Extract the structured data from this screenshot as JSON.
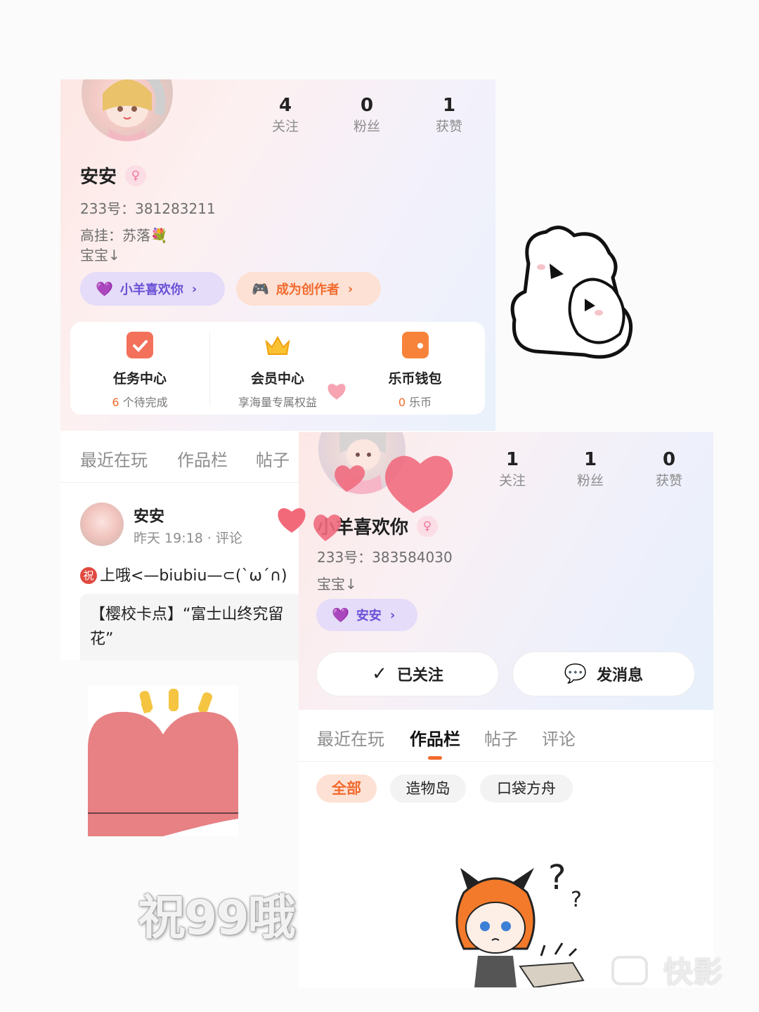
{
  "profile_a": {
    "stats": [
      {
        "value": "4",
        "label": "关注"
      },
      {
        "value": "0",
        "label": "粉丝"
      },
      {
        "value": "1",
        "label": "获赞"
      }
    ],
    "name": "安安",
    "gender_icon": "female-icon",
    "id_line": "233号：381283211",
    "bio_line1": "高挂：苏落💐",
    "bio_line2": "宝宝↓",
    "pills": [
      {
        "icon": "heart-icon",
        "label": "小羊喜欢你"
      },
      {
        "icon": "gamepad-icon",
        "label": "成为创作者"
      }
    ],
    "panel": [
      {
        "icon": "calendar-check-icon",
        "title": "任务中心",
        "sub_highlight": "6",
        "sub": " 个待完成"
      },
      {
        "icon": "crown-icon",
        "title": "会员中心",
        "sub_highlight": "",
        "sub": "享海量专属权益"
      },
      {
        "icon": "wallet-icon",
        "title": "乐币钱包",
        "sub_highlight": "0",
        "sub": " 乐币"
      }
    ],
    "tabs": [
      "最近在玩",
      "作品栏",
      "帖子"
    ],
    "post": {
      "author": "安安",
      "meta": "昨天 19:18 · 评论",
      "badge": "祝",
      "text": "上哦<—biubiu—⊂(`ω´∩)",
      "quote": "【樱校卡点】“富士山终究留花”"
    }
  },
  "profile_b": {
    "stats": [
      {
        "value": "1",
        "label": "关注"
      },
      {
        "value": "1",
        "label": "粉丝"
      },
      {
        "value": "0",
        "label": "获赞"
      }
    ],
    "name": "小羊喜欢你",
    "gender_icon": "female-icon",
    "id_line": "233号：383584030",
    "bio_line1": "宝宝↓",
    "pill": {
      "icon": "heart-icon",
      "label": "安安"
    },
    "follow_button": "已关注",
    "message_button": "发消息",
    "tabs": [
      "最近在玩",
      "作品栏",
      "帖子",
      "评论"
    ],
    "active_tab": "作品栏",
    "chips": [
      "全部",
      "造物岛",
      "口袋方舟"
    ],
    "active_chip": "全部"
  },
  "caption": "祝99哦",
  "watermark": "快影",
  "colors": {
    "accent_orange": "#f26a2e",
    "accent_purple": "#6a4ed6",
    "heart_pink": "#f06b7e"
  }
}
